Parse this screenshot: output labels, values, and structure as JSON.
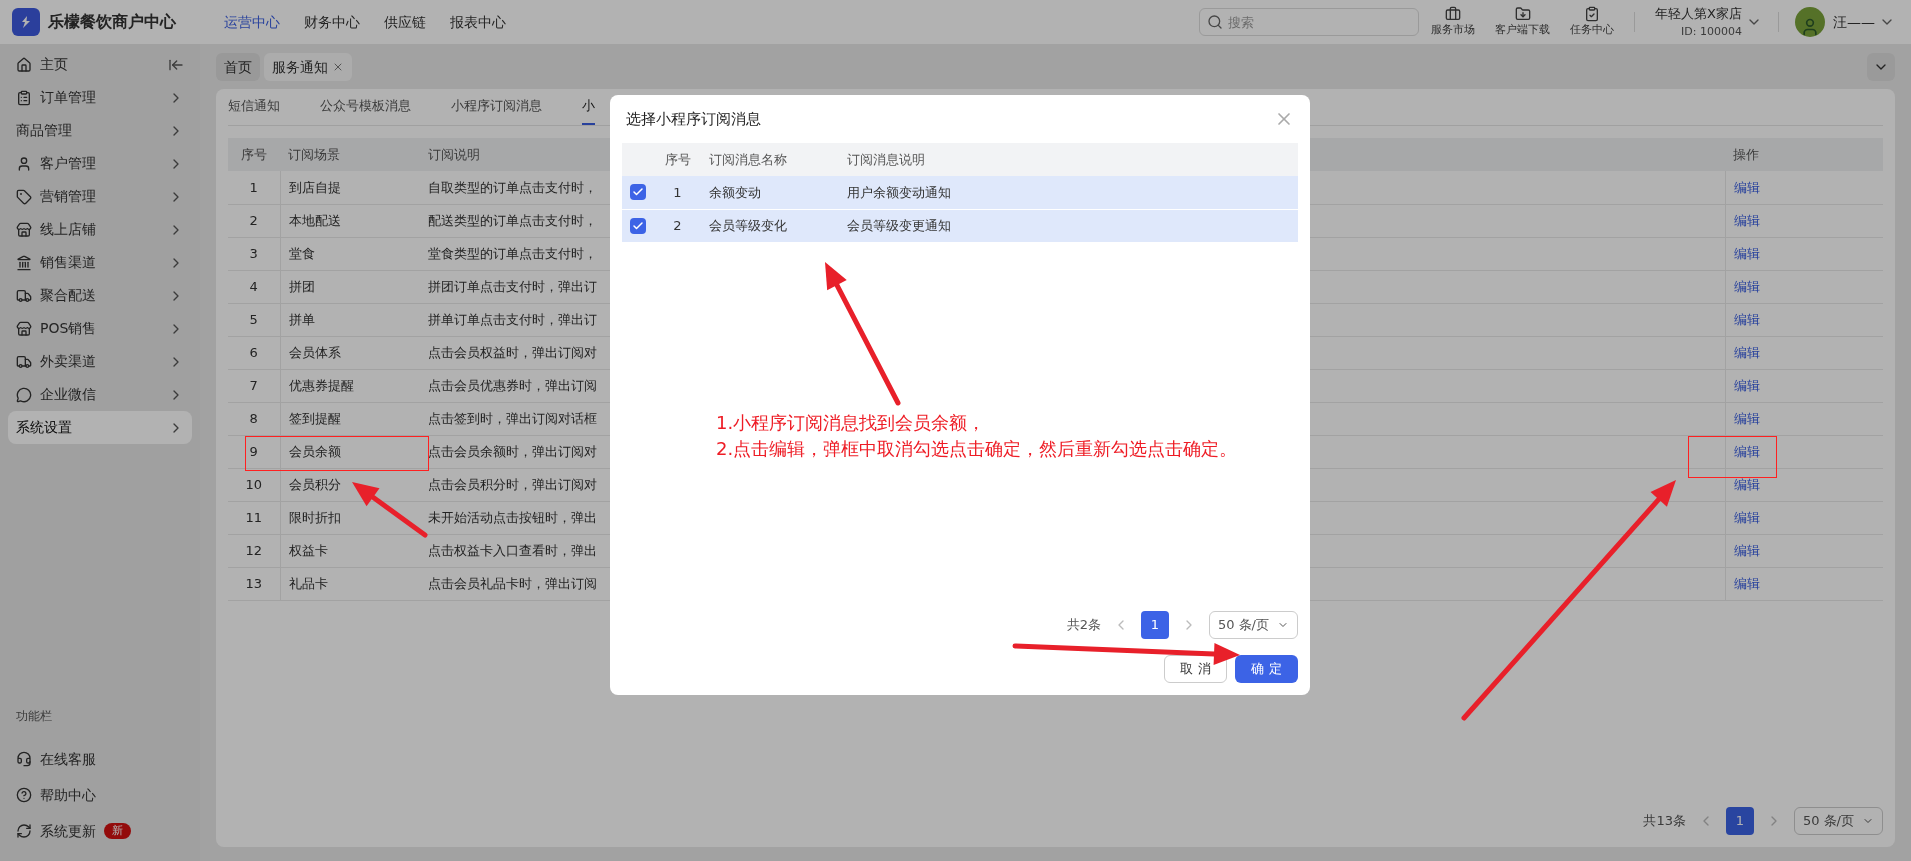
{
  "app": {
    "name": "乐檬餐饮商户中心"
  },
  "top_nav": [
    {
      "label": "运营中心",
      "selected": true
    },
    {
      "label": "财务中心",
      "selected": false
    },
    {
      "label": "供应链",
      "selected": false
    },
    {
      "label": "报表中心",
      "selected": false
    }
  ],
  "search": {
    "placeholder": "搜索"
  },
  "toolbar": [
    "服务市场",
    "客户端下载",
    "任务中心"
  ],
  "store": {
    "name": "年轻人第X家店",
    "id": "ID: 100004"
  },
  "user": {
    "name": "汪——"
  },
  "sidebar": {
    "items": [
      {
        "label": "主页",
        "selected": false
      },
      {
        "label": "订单管理",
        "selected": false
      },
      {
        "label": "商品管理",
        "selected": false
      },
      {
        "label": "客户管理",
        "selected": false
      },
      {
        "label": "营销管理",
        "selected": false
      },
      {
        "label": "线上店铺",
        "selected": false
      },
      {
        "label": "销售渠道",
        "selected": false
      },
      {
        "label": "聚合配送",
        "selected": false
      },
      {
        "label": "POS销售",
        "selected": false
      },
      {
        "label": "外卖渠道",
        "selected": false
      },
      {
        "label": "企业微信",
        "selected": false
      },
      {
        "label": "系统设置",
        "selected": true
      }
    ],
    "footer_title": "功能栏",
    "footer_items": [
      {
        "label": "在线客服"
      },
      {
        "label": "帮助中心"
      },
      {
        "label": "系统更新",
        "badge": "新"
      }
    ]
  },
  "page_tabs": [
    {
      "label": "首页",
      "selected": false,
      "closable": false
    },
    {
      "label": "服务通知",
      "selected": true,
      "closable": true
    }
  ],
  "sub_tabs": [
    {
      "label": "短信通知",
      "selected": false
    },
    {
      "label": "公众号模板消息",
      "selected": false
    },
    {
      "label": "小程序订阅消息",
      "selected": false
    },
    {
      "label": "小",
      "selected": true
    }
  ],
  "table": {
    "columns": [
      "序号",
      "订阅场景",
      "订阅说明",
      "操作"
    ],
    "rows": [
      {
        "index": "1",
        "scene": "到店自提",
        "description": "自取类型的订单点击支付时，",
        "action": "编辑"
      },
      {
        "index": "2",
        "scene": "本地配送",
        "description": "配送类型的订单点击支付时，",
        "action": "编辑"
      },
      {
        "index": "3",
        "scene": "堂食",
        "description": "堂食类型的订单点击支付时，",
        "action": "编辑"
      },
      {
        "index": "4",
        "scene": "拼团",
        "description": "拼团订单点击支付时，弹出订",
        "action": "编辑"
      },
      {
        "index": "5",
        "scene": "拼单",
        "description": "拼单订单点击支付时，弹出订",
        "action": "编辑"
      },
      {
        "index": "6",
        "scene": "会员体系",
        "description": "点击会员权益时，弹出订阅对",
        "action": "编辑"
      },
      {
        "index": "7",
        "scene": "优惠券提醒",
        "description": "点击会员优惠券时，弹出订阅",
        "action": "编辑"
      },
      {
        "index": "8",
        "scene": "签到提醒",
        "description": "点击签到时，弹出订阅对话框",
        "action": "编辑"
      },
      {
        "index": "9",
        "scene": "会员余额",
        "description": "点击会员余额时，弹出订阅对",
        "action": "编辑"
      },
      {
        "index": "10",
        "scene": "会员积分",
        "description": "点击会员积分时，弹出订阅对",
        "action": "编辑"
      },
      {
        "index": "11",
        "scene": "限时折扣",
        "description": "未开始活动点击按钮时，弹出",
        "action": "编辑"
      },
      {
        "index": "12",
        "scene": "权益卡",
        "description": "点击权益卡入口查看时，弹出",
        "action": "编辑"
      },
      {
        "index": "13",
        "scene": "礼品卡",
        "description": "点击会员礼品卡时，弹出订阅",
        "action": "编辑"
      }
    ]
  },
  "pagination": {
    "total": "共13条",
    "page": "1",
    "page_size": "50 条/页"
  },
  "dialog": {
    "title": "选择小程序订阅消息",
    "columns": [
      "序号",
      "订阅消息名称",
      "订阅消息说明"
    ],
    "rows": [
      {
        "checked": true,
        "index": "1",
        "name": "余额变动",
        "description": "用户余额变动通知"
      },
      {
        "checked": true,
        "index": "2",
        "name": "会员等级变化",
        "description": "会员等级变更通知"
      }
    ],
    "pagination": {
      "total": "共2条",
      "page": "1",
      "page_size": "50 条/页"
    },
    "buttons": [
      {
        "label": "取 消",
        "kind": "secondary"
      },
      {
        "label": "确 定",
        "kind": "primary"
      }
    ]
  },
  "annotation": {
    "lines": [
      "1.小程序订阅消息找到会员余额，",
      "2.点击编辑，弹框中取消勾选点击确定，然后重新勾选点击确定。"
    ]
  }
}
